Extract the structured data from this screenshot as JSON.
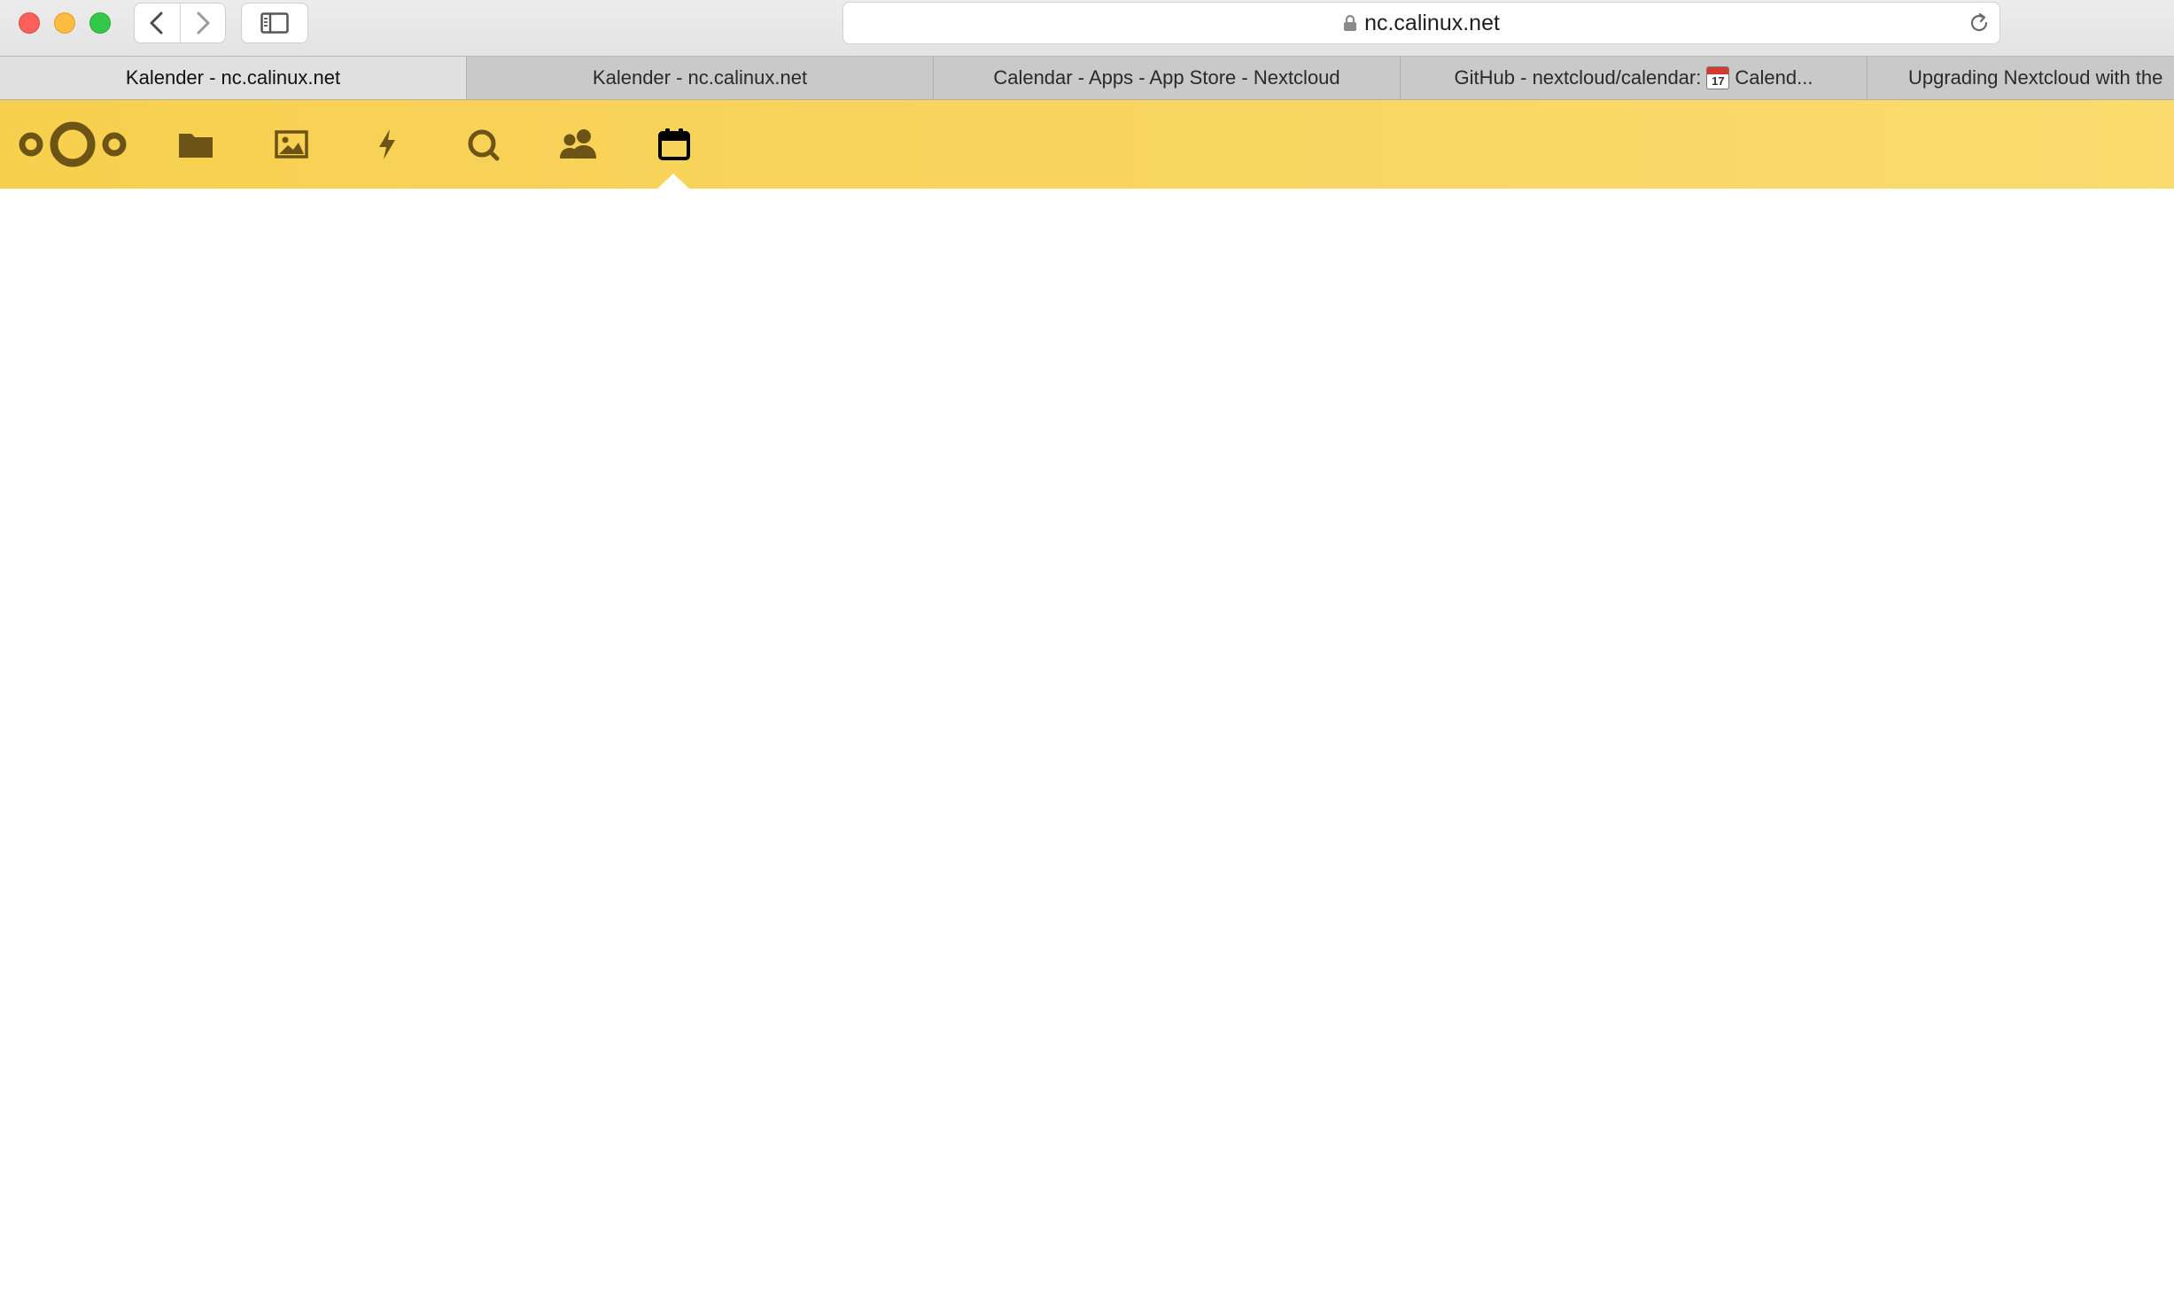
{
  "browser": {
    "address_url": "nc.calinux.net",
    "tabs": [
      {
        "label": "Kalender - nc.calinux.net",
        "active": true
      },
      {
        "label": "Kalender - nc.calinux.net",
        "active": false
      },
      {
        "label": "Calendar - Apps - App Store - Nextcloud",
        "active": false
      },
      {
        "label_prefix": "GitHub - nextcloud/calendar:",
        "label_suffix": "Calend...",
        "active": false
      },
      {
        "label": "Upgrading Nextcloud with the",
        "active": false
      }
    ]
  },
  "nextcloud": {
    "header_color": "#f9d560",
    "icon_color": "#6b5415",
    "active_icon_color": "#000000",
    "apps": [
      {
        "name": "files",
        "icon": "folder-icon"
      },
      {
        "name": "photos",
        "icon": "image-icon"
      },
      {
        "name": "activity",
        "icon": "lightning-icon"
      },
      {
        "name": "search",
        "icon": "search-icon"
      },
      {
        "name": "contacts",
        "icon": "contacts-icon"
      },
      {
        "name": "calendar",
        "icon": "calendar-icon",
        "active": true
      }
    ]
  }
}
